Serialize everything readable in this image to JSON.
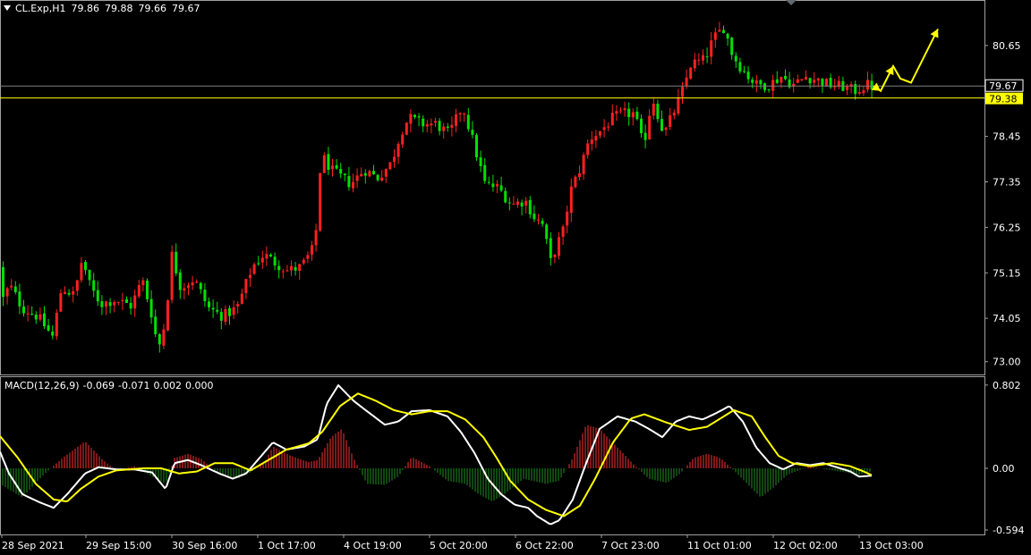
{
  "header": {
    "symbol": "CL.Exp,H1",
    "open": "79.86",
    "high": "79.88",
    "low": "79.66",
    "close": "79.67"
  },
  "colors": {
    "background": "#000000",
    "bull": "#ff2020",
    "bear": "#00e000",
    "level_line": "#ffff00",
    "bid_line": "#808080",
    "macd_line": "#ffffff",
    "signal_line": "#ffff00",
    "hist_pos": "#ff3030",
    "hist_neg": "#1f8f1f",
    "grid": "#a0a0a0"
  },
  "chart_data": [
    {
      "type": "candlestick",
      "title": "CL.Exp,H1",
      "ylim": [
        72.6,
        81.8
      ],
      "ticks": [
        80.65,
        79.55,
        78.45,
        77.35,
        76.25,
        75.15,
        74.05,
        73.0
      ],
      "tick_labels": [
        "80.65",
        "78.45",
        "77.35",
        "76.25",
        "75.15",
        "74.05",
        "73.00"
      ],
      "current_price": {
        "value": 79.67,
        "label": "79.67"
      },
      "level": {
        "value": 79.38,
        "label": "79.38"
      },
      "path": [
        [
          0,
          75.3
        ],
        [
          6,
          74.5
        ],
        [
          14,
          74.85
        ],
        [
          28,
          74.3
        ],
        [
          45,
          74.1
        ],
        [
          62,
          73.6
        ],
        [
          72,
          74.8
        ],
        [
          86,
          74.6
        ],
        [
          95,
          75.5
        ],
        [
          104,
          74.8
        ],
        [
          116,
          74.4
        ],
        [
          132,
          74.5
        ],
        [
          150,
          74.35
        ],
        [
          162,
          75.0
        ],
        [
          172,
          74.2
        ],
        [
          180,
          73.3
        ],
        [
          188,
          74.0
        ],
        [
          195,
          75.6
        ],
        [
          205,
          74.8
        ],
        [
          220,
          75.0
        ],
        [
          236,
          74.3
        ],
        [
          252,
          74.1
        ],
        [
          268,
          74.3
        ],
        [
          285,
          75.3
        ],
        [
          298,
          75.6
        ],
        [
          310,
          75.4
        ],
        [
          325,
          75.2
        ],
        [
          340,
          75.3
        ],
        [
          355,
          75.8
        ],
        [
          362,
          78.0
        ],
        [
          375,
          77.6
        ],
        [
          395,
          77.3
        ],
        [
          410,
          77.65
        ],
        [
          425,
          77.45
        ],
        [
          440,
          77.8
        ],
        [
          452,
          78.6
        ],
        [
          460,
          78.9
        ],
        [
          475,
          78.75
        ],
        [
          490,
          78.75
        ],
        [
          505,
          78.5
        ],
        [
          520,
          79.2
        ],
        [
          532,
          78.3
        ],
        [
          545,
          77.3
        ],
        [
          560,
          77.2
        ],
        [
          575,
          76.8
        ],
        [
          590,
          76.9
        ],
        [
          600,
          76.5
        ],
        [
          610,
          76.3
        ],
        [
          618,
          75.4
        ],
        [
          625,
          75.8
        ],
        [
          633,
          76.2
        ],
        [
          640,
          77.1
        ],
        [
          650,
          77.6
        ],
        [
          662,
          78.4
        ],
        [
          675,
          78.6
        ],
        [
          688,
          78.9
        ],
        [
          700,
          79.0
        ],
        [
          712,
          79.0
        ],
        [
          722,
          78.2
        ],
        [
          732,
          79.4
        ],
        [
          745,
          78.5
        ],
        [
          755,
          79.0
        ],
        [
          765,
          79.5
        ],
        [
          775,
          80.2
        ],
        [
          790,
          80.3
        ],
        [
          800,
          80.8
        ],
        [
          812,
          81.1
        ],
        [
          822,
          80.4
        ],
        [
          835,
          80.0
        ],
        [
          848,
          79.7
        ],
        [
          862,
          79.7
        ],
        [
          876,
          79.9
        ],
        [
          890,
          79.7
        ],
        [
          904,
          79.9
        ],
        [
          918,
          79.8
        ],
        [
          930,
          79.7
        ],
        [
          945,
          79.65
        ],
        [
          958,
          79.55
        ],
        [
          972,
          79.7
        ],
        [
          976,
          79.67
        ]
      ],
      "forecast": [
        [
          976,
          79.67
        ],
        [
          984,
          79.55
        ],
        [
          998,
          80.15
        ],
        [
          1006,
          79.85
        ],
        [
          1018,
          79.75
        ],
        [
          1048,
          81.05
        ]
      ],
      "xticks": [
        "28 Sep 2021",
        "29 Sep 15:00",
        "30 Sep 16:00",
        "1 Oct 17:00",
        "4 Oct 19:00",
        "5 Oct 20:00",
        "6 Oct 22:00",
        "7 Oct 23:00",
        "11 Oct 01:00",
        "12 Oct 02:00",
        "13 Oct 03:00"
      ]
    },
    {
      "type": "macd",
      "title": "MACD(12,26,9)",
      "values": [
        "-0.069",
        "-0.071",
        "0.002",
        "0.000"
      ],
      "ylim": [
        -0.594,
        0.802
      ],
      "tick_labels": [
        "0.802",
        "0.00",
        "-0.594"
      ],
      "macd": [
        [
          0,
          0.16
        ],
        [
          10,
          -0.05
        ],
        [
          25,
          -0.25
        ],
        [
          45,
          -0.33
        ],
        [
          60,
          -0.38
        ],
        [
          75,
          -0.25
        ],
        [
          95,
          -0.05
        ],
        [
          110,
          0.01
        ],
        [
          130,
          -0.01
        ],
        [
          150,
          -0.01
        ],
        [
          170,
          -0.04
        ],
        [
          185,
          -0.2
        ],
        [
          195,
          0.05
        ],
        [
          210,
          0.08
        ],
        [
          225,
          0.03
        ],
        [
          245,
          -0.05
        ],
        [
          260,
          -0.1
        ],
        [
          275,
          -0.05
        ],
        [
          290,
          0.1
        ],
        [
          305,
          0.25
        ],
        [
          320,
          0.18
        ],
        [
          340,
          0.21
        ],
        [
          355,
          0.28
        ],
        [
          365,
          0.62
        ],
        [
          378,
          0.8
        ],
        [
          395,
          0.65
        ],
        [
          410,
          0.55
        ],
        [
          430,
          0.42
        ],
        [
          445,
          0.45
        ],
        [
          460,
          0.55
        ],
        [
          480,
          0.56
        ],
        [
          500,
          0.5
        ],
        [
          515,
          0.35
        ],
        [
          530,
          0.15
        ],
        [
          545,
          -0.1
        ],
        [
          560,
          -0.25
        ],
        [
          575,
          -0.35
        ],
        [
          590,
          -0.38
        ],
        [
          600,
          -0.46
        ],
        [
          615,
          -0.54
        ],
        [
          625,
          -0.5
        ],
        [
          640,
          -0.3
        ],
        [
          655,
          0.05
        ],
        [
          670,
          0.38
        ],
        [
          690,
          0.5
        ],
        [
          710,
          0.45
        ],
        [
          725,
          0.38
        ],
        [
          740,
          0.3
        ],
        [
          755,
          0.45
        ],
        [
          770,
          0.5
        ],
        [
          785,
          0.47
        ],
        [
          800,
          0.53
        ],
        [
          815,
          0.6
        ],
        [
          830,
          0.45
        ],
        [
          845,
          0.2
        ],
        [
          860,
          0.05
        ],
        [
          875,
          -0.01
        ],
        [
          890,
          0.05
        ],
        [
          905,
          0.03
        ],
        [
          920,
          0.05
        ],
        [
          935,
          0.01
        ],
        [
          950,
          -0.03
        ],
        [
          960,
          -0.08
        ],
        [
          975,
          -0.07
        ]
      ],
      "signal": [
        [
          0,
          0.31
        ],
        [
          20,
          0.1
        ],
        [
          40,
          -0.15
        ],
        [
          60,
          -0.3
        ],
        [
          75,
          -0.32
        ],
        [
          90,
          -0.2
        ],
        [
          110,
          -0.08
        ],
        [
          130,
          -0.02
        ],
        [
          160,
          0.0
        ],
        [
          180,
          0.0
        ],
        [
          200,
          -0.05
        ],
        [
          220,
          -0.03
        ],
        [
          240,
          0.05
        ],
        [
          260,
          0.05
        ],
        [
          280,
          -0.02
        ],
        [
          300,
          0.08
        ],
        [
          320,
          0.18
        ],
        [
          345,
          0.24
        ],
        [
          360,
          0.35
        ],
        [
          380,
          0.6
        ],
        [
          400,
          0.72
        ],
        [
          420,
          0.65
        ],
        [
          440,
          0.56
        ],
        [
          460,
          0.52
        ],
        [
          480,
          0.55
        ],
        [
          500,
          0.55
        ],
        [
          520,
          0.47
        ],
        [
          540,
          0.3
        ],
        [
          555,
          0.1
        ],
        [
          570,
          -0.12
        ],
        [
          590,
          -0.3
        ],
        [
          610,
          -0.4
        ],
        [
          630,
          -0.46
        ],
        [
          648,
          -0.36
        ],
        [
          665,
          -0.1
        ],
        [
          685,
          0.25
        ],
        [
          705,
          0.48
        ],
        [
          720,
          0.52
        ],
        [
          745,
          0.44
        ],
        [
          770,
          0.37
        ],
        [
          790,
          0.4
        ],
        [
          820,
          0.56
        ],
        [
          840,
          0.5
        ],
        [
          855,
          0.3
        ],
        [
          870,
          0.12
        ],
        [
          885,
          0.05
        ],
        [
          905,
          0.02
        ],
        [
          930,
          0.05
        ],
        [
          950,
          0.02
        ],
        [
          965,
          -0.03
        ],
        [
          975,
          -0.07
        ]
      ],
      "hist": [
        [
          0,
          -0.15
        ],
        [
          25,
          -0.28
        ],
        [
          50,
          -0.05
        ],
        [
          70,
          0.1
        ],
        [
          95,
          0.26
        ],
        [
          115,
          0.08
        ],
        [
          130,
          -0.02
        ],
        [
          150,
          0.02
        ],
        [
          170,
          -0.08
        ],
        [
          185,
          -0.15
        ],
        [
          195,
          0.1
        ],
        [
          210,
          0.14
        ],
        [
          225,
          0.09
        ],
        [
          245,
          -0.06
        ],
        [
          265,
          -0.1
        ],
        [
          280,
          -0.04
        ],
        [
          295,
          0.05
        ],
        [
          305,
          0.21
        ],
        [
          325,
          0.12
        ],
        [
          345,
          0.06
        ],
        [
          355,
          0.08
        ],
        [
          370,
          0.3
        ],
        [
          382,
          0.38
        ],
        [
          395,
          0.1
        ],
        [
          410,
          -0.15
        ],
        [
          430,
          -0.16
        ],
        [
          445,
          -0.08
        ],
        [
          460,
          0.11
        ],
        [
          480,
          0.02
        ],
        [
          500,
          -0.12
        ],
        [
          520,
          -0.15
        ],
        [
          535,
          -0.25
        ],
        [
          550,
          -0.32
        ],
        [
          565,
          -0.24
        ],
        [
          585,
          -0.1
        ],
        [
          610,
          -0.15
        ],
        [
          625,
          -0.12
        ],
        [
          640,
          0.1
        ],
        [
          655,
          0.42
        ],
        [
          670,
          0.38
        ],
        [
          690,
          0.2
        ],
        [
          710,
          0.02
        ],
        [
          725,
          -0.1
        ],
        [
          745,
          -0.14
        ],
        [
          760,
          -0.05
        ],
        [
          775,
          0.1
        ],
        [
          790,
          0.14
        ],
        [
          805,
          0.1
        ],
        [
          820,
          -0.02
        ],
        [
          835,
          -0.15
        ],
        [
          850,
          -0.28
        ],
        [
          865,
          -0.18
        ],
        [
          880,
          -0.06
        ],
        [
          905,
          0.02
        ],
        [
          930,
          -0.02
        ],
        [
          960,
          -0.06
        ],
        [
          975,
          -0.03
        ]
      ]
    }
  ]
}
